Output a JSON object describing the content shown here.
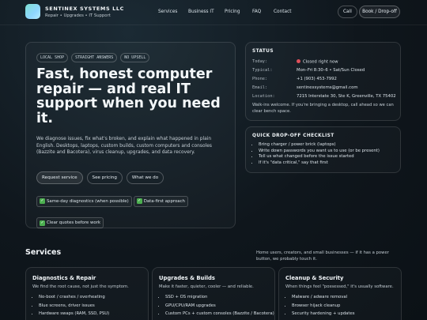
{
  "brand": {
    "name": "SENTINEX SYSTEMS LLC",
    "tagline": "Repair • Upgrades • IT Support"
  },
  "nav": [
    "Services",
    "Business IT",
    "Pricing",
    "FAQ",
    "Contact"
  ],
  "header_actions": {
    "call": "Call",
    "book": "Book / Drop-off"
  },
  "hero": {
    "chips": [
      "LOCAL SHOP",
      "STRAIGHT ANSWERS",
      "NO UPSELL"
    ],
    "title": "Fast, honest computer repair — and real IT support when you need it.",
    "description": "We diagnose issues, fix what's broken, and explain what happened in plain English. Desktops, laptops, custom builds, custom computers and consoles (Bazzite and Bacotera), virus cleanup, upgrades, and data recovery.",
    "buttons": [
      "Request service",
      "See pricing",
      "What we do"
    ],
    "badges": [
      "Same-day diagnostics (when possible)",
      "Data-first approach",
      "Clear quotes before work"
    ]
  },
  "status": {
    "title": "STATUS",
    "rows": [
      {
        "key": "Today:",
        "value": "Closed right now"
      },
      {
        "key": "Typical:",
        "value": "Mon–Fri 8:30–6 • Sat/Sun Closed"
      },
      {
        "key": "Phone:",
        "value": "+1 (903) 453-7992"
      },
      {
        "key": "Email:",
        "value": "sentinexsystems@gmail.com"
      },
      {
        "key": "Location:",
        "value": "7215 Interstate 30, Ste K, Greenville, TX 75402"
      }
    ],
    "walkin": "Walk-ins welcome. If you're bringing a desktop, call ahead so we can clear bench space."
  },
  "checklist": {
    "title": "QUICK DROP-OFF CHECKLIST",
    "items": [
      "Bring charger / power brick (laptops)",
      "Write down passwords you want us to use (or be present)",
      "Tell us what changed before the issue started",
      "If it's \"data critical,\" say that first"
    ]
  },
  "services": {
    "title": "Services",
    "description": "Home users, creators, and small businesses — if it has a power button, we probably touch it.",
    "cards": [
      {
        "title": "Diagnostics & Repair",
        "subtitle": "We find the root cause, not just the symptom.",
        "items": [
          "No-boot / crashes / overheating",
          "Blue screens, driver issues",
          "Hardware swaps (RAM, SSD, PSU)"
        ]
      },
      {
        "title": "Upgrades & Builds",
        "subtitle": "Make it faster, quieter, cooler — and reliable.",
        "items": [
          "SSD + OS migration",
          "GPU/CPU/RAM upgrades",
          "Custom PCs + custom consoles (Bazzite / Bacotera)"
        ]
      },
      {
        "title": "Cleanup & Security",
        "subtitle": "When things feel \"possessed,\" it's usually software.",
        "items": [
          "Malware / adware removal",
          "Browser hijack cleanup",
          "Security hardening + updates"
        ]
      }
    ]
  }
}
